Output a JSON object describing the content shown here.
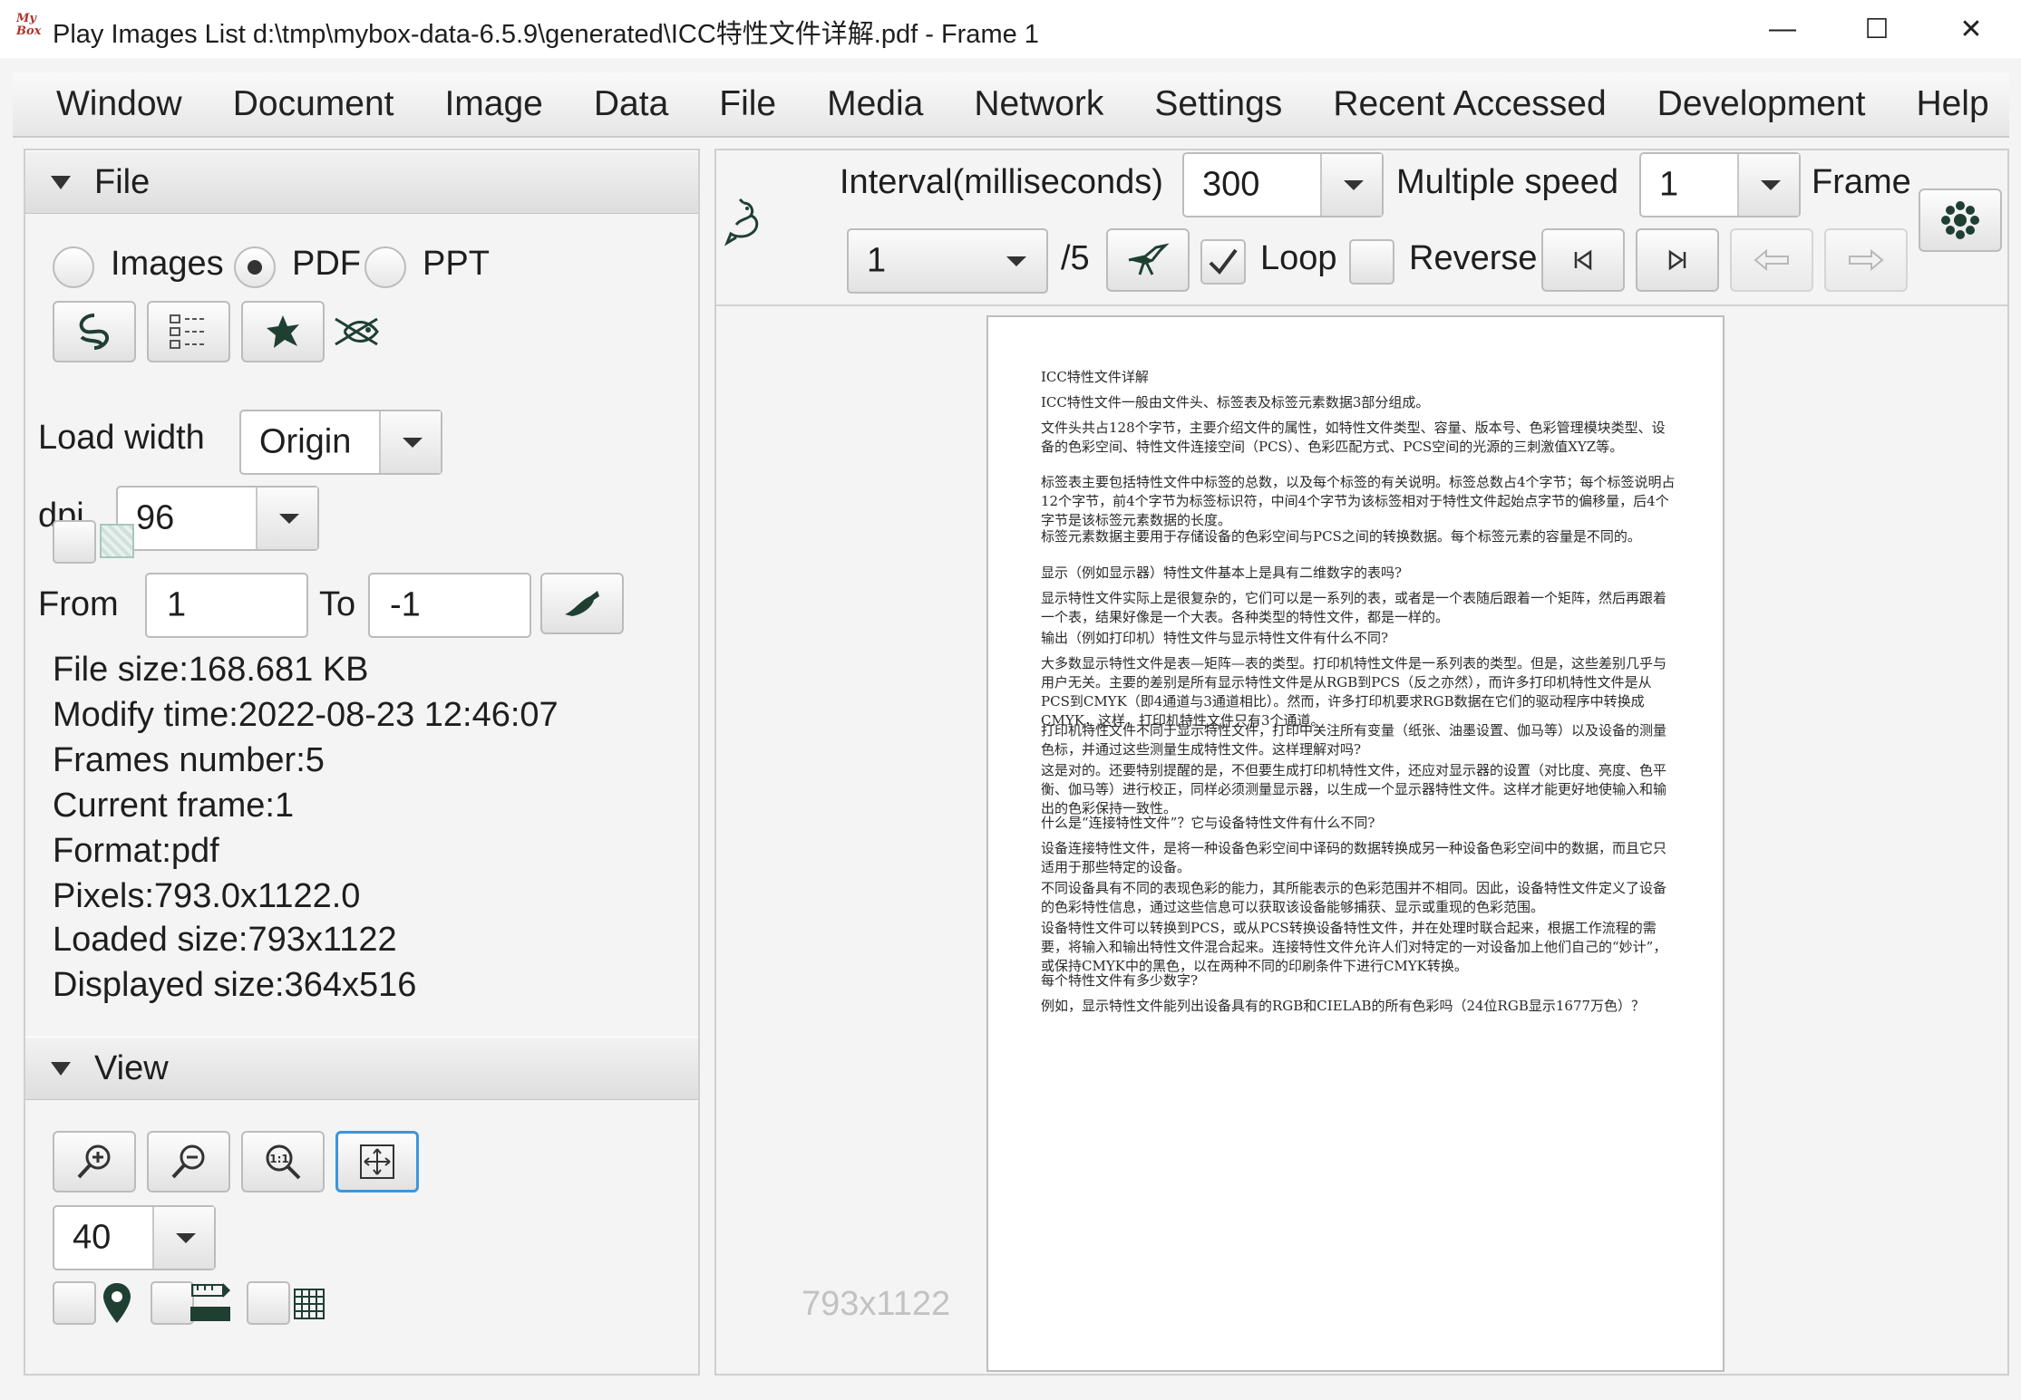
{
  "window": {
    "title": "Play Images List d:\\tmp\\mybox-data-6.5.9\\generated\\ICC特性文件详解.pdf - Frame 1",
    "app_icon_text": "My Box",
    "minimize": "—",
    "maximize": "☐",
    "close": "✕"
  },
  "menu": [
    "Window",
    "Document",
    "Image",
    "Data",
    "File",
    "Media",
    "Network",
    "Settings",
    "Recent Accessed",
    "Development",
    "Help"
  ],
  "file_section": {
    "title": "File",
    "radio_images": "Images",
    "radio_pdf": "PDF",
    "radio_ppt": "PPT",
    "selected": "PDF",
    "load_width_label": "Load width",
    "load_width_value": "Origin",
    "dpi_label": "dpi",
    "dpi_value": "96",
    "from_label": "From",
    "from_value": "1",
    "to_label": "To",
    "to_value": "-1",
    "info": [
      "File size:168.681 KB",
      "Modify time:2022-08-23 12:46:07",
      "Frames number:5",
      "Current frame:1",
      "Format:pdf",
      "Pixels:793.0x1122.0",
      "Loaded size:793x1122",
      "Displayed size:364x516"
    ]
  },
  "view_section": {
    "title": "View",
    "zoom_value": "40"
  },
  "player": {
    "interval_label": "Interval(milliseconds)",
    "interval_value": "300",
    "speed_label": "Multiple speed",
    "speed_value": "1",
    "frame_label": "Frame",
    "frame_value": "1",
    "frame_total": "/5",
    "loop_label": "Loop",
    "loop_checked": true,
    "reverse_label": "Reverse",
    "reverse_checked": false
  },
  "viewer": {
    "dimensions": "793x1122",
    "page_lines": [
      "ICC特性文件详解",
      "ICC特性文件一般由文件头、标签表及标签元素数据3部分组成。",
      "文件头共占128个字节，主要介绍文件的属性，如特性文件类型、容量、版本号、色彩管理模块类型、设备的色彩空间、特性文件连接空间（PCS）、色彩匹配方式、PCS空间的光源的三刺激值XYZ等。",
      "标签表主要包括特性文件中标签的总数，以及每个标签的有关说明。标签总数占4个字节；每个标签说明占12个字节，前4个字节为标签标识符，中间4个字节为该标签相对于特性文件起始点字节的偏移量，后4个字节是该标签元素数据的长度。",
      "标签元素数据主要用于存储设备的色彩空间与PCS之间的转换数据。每个标签元素的容量是不同的。",
      "显示（例如显示器）特性文件基本上是具有二维数字的表吗?",
      "显示特性文件实际上是很复杂的，它们可以是一系列的表，或者是一个表随后跟着一个矩阵，然后再跟着一个表，结果好像是一个大表。各种类型的特性文件，都是一样的。",
      "输出（例如打印机）特性文件与显示特性文件有什么不同?",
      "大多数显示特性文件是表—矩阵—表的类型。打印机特性文件是一系列表的类型。但是，这些差别几乎与用户无关。主要的差别是所有显示特性文件是从RGB到PCS（反之亦然），而许多打印机特性文件是从PCS到CMYK（即4通道与3通道相比）。然而，许多打印机要求RGB数据在它们的驱动程序中转换成CMYK，这样，打印机特性文件只有3个通道。",
      "打印机特性文件不同于显示特性文件，打印中关注所有变量（纸张、油墨设置、伽马等）以及设备的测量色标，并通过这些测量生成特性文件。这样理解对吗?",
      "这是对的。还要特别提醒的是，不但要生成打印机特性文件，还应对显示器的设置（对比度、亮度、色平衡、伽马等）进行校正，同样必须测量显示器，以生成一个显示器特性文件。这样才能更好地使输入和输出的色彩保持一致性。",
      "什么是“连接特性文件”？它与设备特性文件有什么不同?",
      "设备连接特性文件，是将一种设备色彩空间中译码的数据转换成另一种设备色彩空间中的数据，而且它只适用于那些特定的设备。",
      "不同设备具有不同的表现色彩的能力，其所能表示的色彩范围并不相同。因此，设备特性文件定义了设备的色彩特性信息，通过这些信息可以获取该设备能够捕获、显示或重现的色彩范围。",
      "设备特性文件可以转换到PCS，或从PCS转换设备特性文件，并在处理时联合起来，根据工作流程的需要，将输入和输出特性文件混合起来。连接特性文件允许人们对特定的一对设备加上他们自己的“妙计”，或保持CMYK中的黑色，以在两种不同的印刷条件下进行CMYK转换。",
      "每个特性文件有多少数字?",
      "例如，显示特性文件能列出设备具有的RGB和CIELAB的所有色彩吗（24位RGB显示1677万色）？"
    ]
  },
  "colors": {
    "icon": "#1f3f33",
    "selected_border": "#3a96dd",
    "dimension_text": "#c2c2c2"
  }
}
